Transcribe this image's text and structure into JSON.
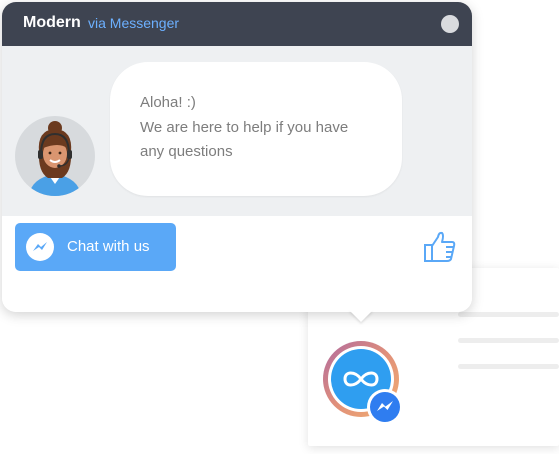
{
  "header": {
    "title": "Modern",
    "subtitle": "via Messenger"
  },
  "message": {
    "lines": [
      "Aloha! :)",
      "We are here to help if you have",
      "any questions"
    ]
  },
  "actions": {
    "chat_button_label": "Chat with us"
  },
  "icons": {
    "close": "close-dot-icon",
    "messenger": "messenger-icon",
    "thumbs_up": "thumbs-up-icon",
    "launcher": "infinity-icon"
  },
  "colors": {
    "header_bg": "#3e4451",
    "accent_blue": "#5aa8f7",
    "subtitle_blue": "#6cb0ff",
    "body_bg": "#eef0f2"
  }
}
